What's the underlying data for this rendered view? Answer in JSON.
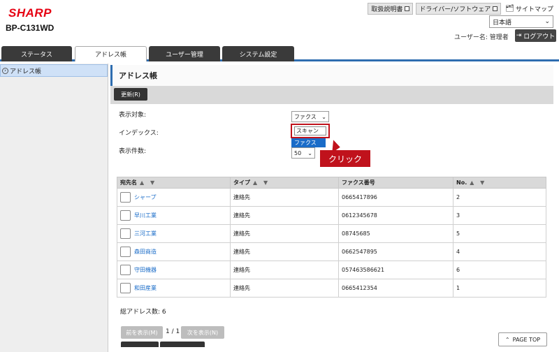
{
  "header": {
    "logo": "SHARP",
    "model": "BP-C131WD",
    "links": [
      "取扱説明書",
      "ドライバー/ソフトウェア"
    ],
    "sitemap": "サイトマップ",
    "language": "日本語",
    "user_label": "ユーザー名: 管理者",
    "logout": "ログアウト"
  },
  "tabs": [
    "ステータス",
    "アドレス帳",
    "ユーザー管理",
    "システム設定"
  ],
  "sidebar": {
    "items": [
      "アドレス帳"
    ]
  },
  "main": {
    "title": "アドレス帳",
    "refresh_button": "更新(R)",
    "filters": {
      "display_target_label": "表示対象:",
      "display_target_value": "ファクス",
      "index_label": "インデックス:",
      "dropdown_options": [
        "スキャン",
        "ファクス"
      ],
      "count_label": "表示件数:",
      "count_value": "50"
    },
    "callout": "クリック",
    "table": {
      "headers": [
        "宛先名",
        "タイプ",
        "ファクス番号",
        "No."
      ],
      "sort_marks": [
        "▲ ▼",
        "▲ ▼",
        "",
        "▲ ▼"
      ],
      "rows": [
        {
          "name": "シャープ",
          "type": "連絡先",
          "fax": "0665417896",
          "no": "2"
        },
        {
          "name": "早川工業",
          "type": "連絡先",
          "fax": "0612345678",
          "no": "3"
        },
        {
          "name": "三河工業",
          "type": "連絡先",
          "fax": "08745685",
          "no": "5"
        },
        {
          "name": "森田商造",
          "type": "連絡先",
          "fax": "0662547895",
          "no": "4"
        },
        {
          "name": "守田機器",
          "type": "連絡先",
          "fax": "057463586621",
          "no": "6"
        },
        {
          "name": "和田産業",
          "type": "連絡先",
          "fax": "0665412354",
          "no": "1"
        }
      ]
    },
    "total": "総アドレス数: 6",
    "pager": {
      "prev": "前を表示(M)",
      "page": "1 / 1",
      "next": "次を表示(N)"
    },
    "page_top": "PAGE TOP"
  },
  "colors": {
    "brand": "#e60012",
    "accent": "#2e6db0",
    "callout": "#c0121c",
    "link": "#1a6cc8"
  }
}
